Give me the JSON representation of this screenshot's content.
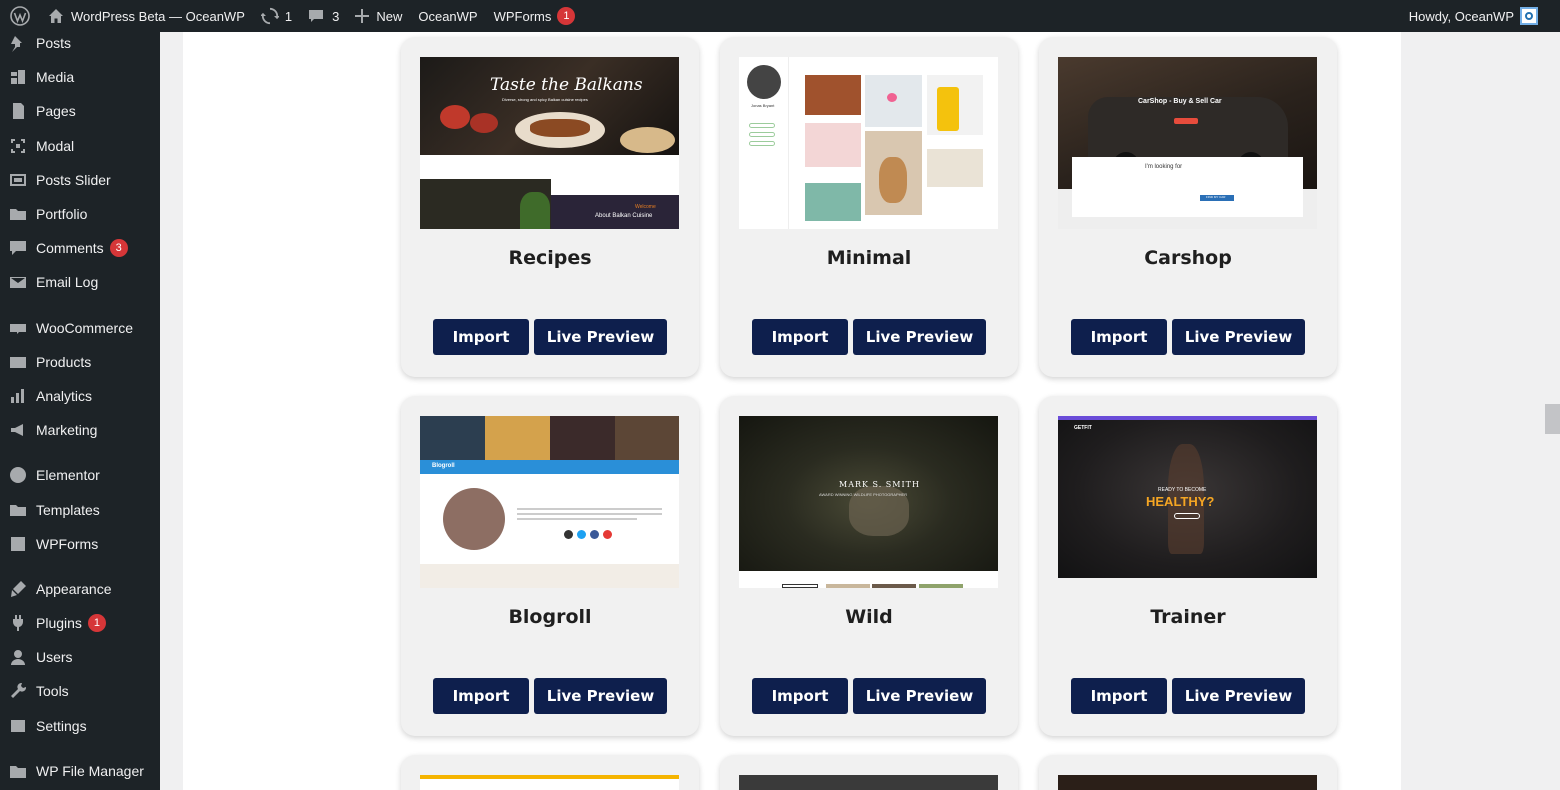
{
  "adminbar": {
    "site_name": "WordPress Beta — OceanWP",
    "updates_count": "1",
    "comments_count": "3",
    "new_label": "New",
    "theme_link": "OceanWP",
    "wpforms_label": "WPForms",
    "wpforms_badge": "1",
    "howdy": "Howdy, OceanWP"
  },
  "sidebar": {
    "items": [
      {
        "label": "Posts",
        "icon": "pin-icon"
      },
      {
        "label": "Media",
        "icon": "media-icon"
      },
      {
        "label": "Pages",
        "icon": "pages-icon"
      },
      {
        "label": "Modal",
        "icon": "modal-icon"
      },
      {
        "label": "Posts Slider",
        "icon": "slider-icon"
      },
      {
        "label": "Portfolio",
        "icon": "folder-icon"
      },
      {
        "label": "Comments",
        "icon": "comment-icon",
        "badge": "3"
      },
      {
        "label": "Email Log",
        "icon": "email-icon"
      },
      {
        "label": "WooCommerce",
        "icon": "woo-icon"
      },
      {
        "label": "Products",
        "icon": "products-icon"
      },
      {
        "label": "Analytics",
        "icon": "analytics-icon"
      },
      {
        "label": "Marketing",
        "icon": "megaphone-icon"
      },
      {
        "label": "Elementor",
        "icon": "elementor-icon"
      },
      {
        "label": "Templates",
        "icon": "folder-icon"
      },
      {
        "label": "WPForms",
        "icon": "forms-icon"
      },
      {
        "label": "Appearance",
        "icon": "brush-icon"
      },
      {
        "label": "Plugins",
        "icon": "plugin-icon",
        "badge": "1"
      },
      {
        "label": "Users",
        "icon": "user-icon"
      },
      {
        "label": "Tools",
        "icon": "wrench-icon"
      },
      {
        "label": "Settings",
        "icon": "settings-icon"
      },
      {
        "label": "WP File Manager",
        "icon": "file-manager-icon"
      }
    ]
  },
  "buttons": {
    "import": "Import",
    "preview": "Live Preview"
  },
  "demos": [
    {
      "name": "Recipes",
      "thumb_text": [
        "Taste the Balkans",
        "Diverse, strong and spicy Balkan cuisine recipes",
        "Welcome",
        "About Balkan Cuisine"
      ]
    },
    {
      "name": "Minimal",
      "thumb_text": [
        "Jonas Bryant"
      ]
    },
    {
      "name": "Carshop",
      "thumb_text": [
        "CarShop - Buy & Sell Car",
        "I'm looking for",
        "FIND MY CAR"
      ]
    },
    {
      "name": "Blogroll",
      "thumb_text": [
        "Blogroll"
      ]
    },
    {
      "name": "Wild",
      "thumb_text": [
        "MARK S. SMITH",
        "AWARD WINNING WILDLIFE PHOTOGRAPHER"
      ]
    },
    {
      "name": "Trainer",
      "thumb_text": [
        "GETFIT",
        "READY TO BECOME",
        "HEALTHY?"
      ]
    }
  ],
  "colors": {
    "button_bg": "#0e1f4d",
    "admin_bg": "#1d2327",
    "badge": "#d63638"
  }
}
